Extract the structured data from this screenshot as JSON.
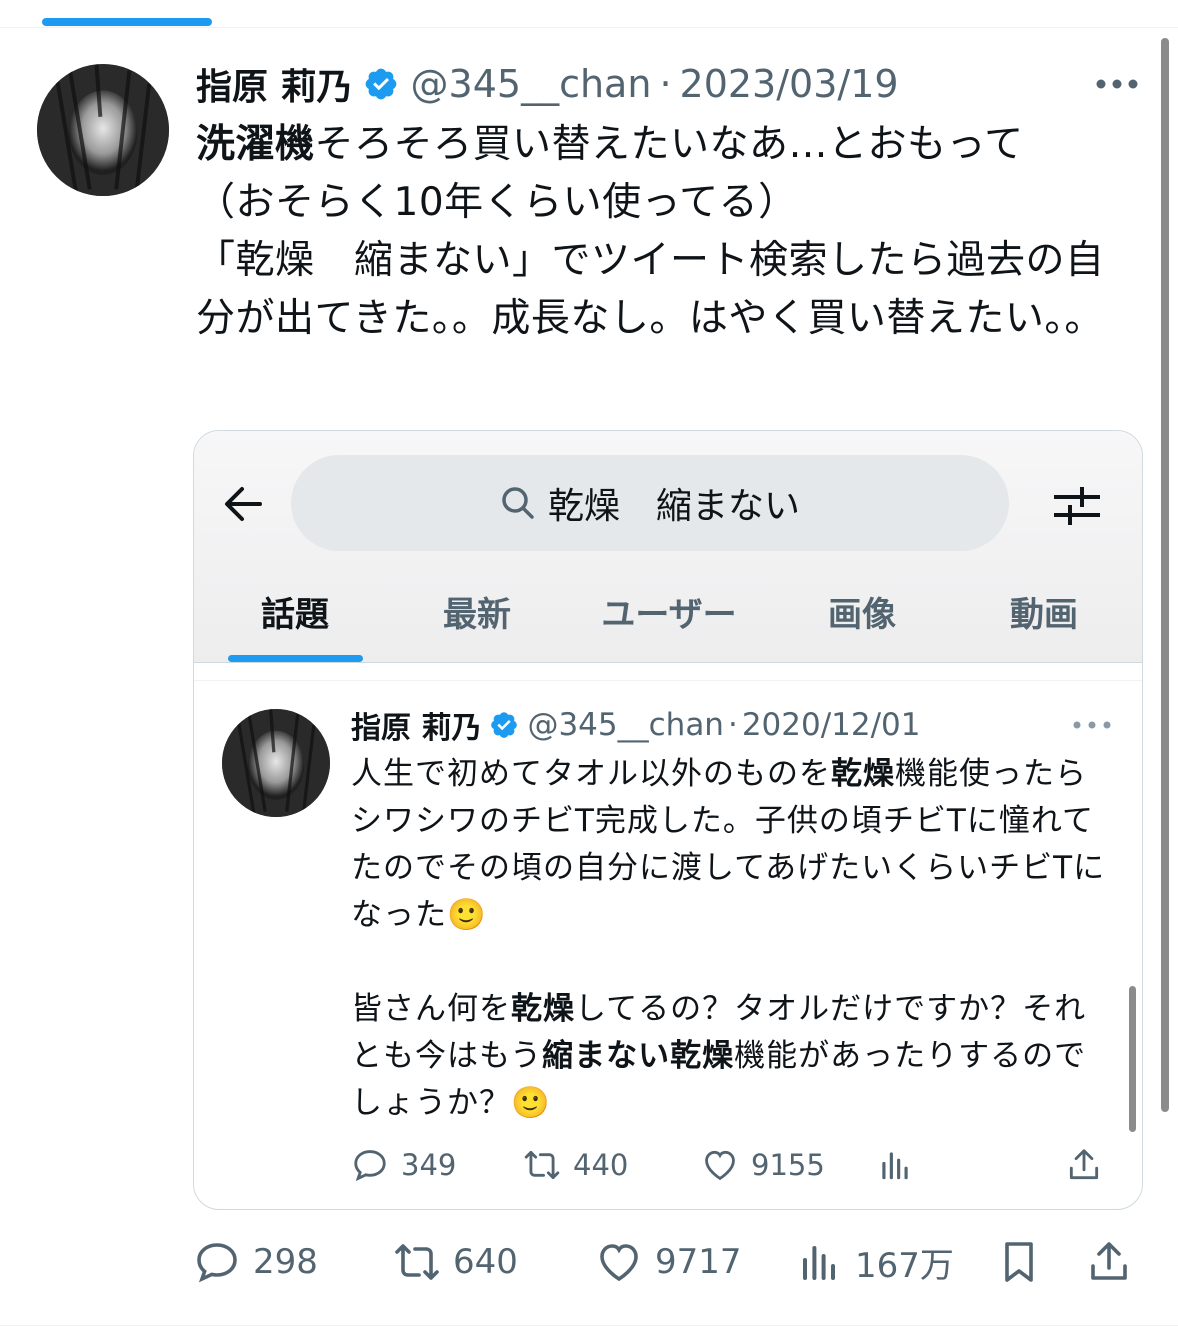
{
  "tweet": {
    "display_name": "指原 莉乃",
    "handle": "@345__chan",
    "separator": "·",
    "date": "2023/03/19",
    "text_bold_prefix": "洗濯機",
    "text_rest": "そろそろ買い替えたいなあ…とおもって\n（おそらく10年くらい使ってる）\n「乾燥　縮まない」でツイート検索したら過去の自分が出てきた。。成長なし。はやく買い替えたい。。",
    "icons": {
      "verified": "verified-badge-icon",
      "more": "more-icon",
      "reply": "reply-icon",
      "retweet": "retweet-icon",
      "like": "heart-icon",
      "views": "views-icon",
      "bookmark": "bookmark-icon",
      "share": "share-icon"
    },
    "stats": {
      "replies": "298",
      "retweets": "640",
      "likes": "9717",
      "views": "167万"
    }
  },
  "screenshot": {
    "search_query": "乾燥　縮まない",
    "tabs": [
      "話題",
      "最新",
      "ユーザー",
      "画像",
      "動画"
    ],
    "active_tab": "話題",
    "icons": {
      "back": "back-arrow-icon",
      "search": "search-icon",
      "filter": "filter-settings-icon"
    },
    "inner_tweet": {
      "display_name": "指原 莉乃",
      "handle": "@345__chan",
      "separator": "·",
      "date": "2020/12/01",
      "segments": [
        "人生で初めてタオル以外のものを",
        "乾燥",
        "機能使ったらシワシワのチビT完成した。子供の頃チビTに憧れてたのでその頃の自分に渡してあげたいくらいチビTになった🙂\n\n皆さん何を",
        "乾燥",
        "してるの？タオルだけですか？それとも今はもう",
        "縮まない乾燥",
        "機能があったりするのでしょうか？🙂"
      ],
      "stats": {
        "replies": "349",
        "retweets": "440",
        "likes": "9155"
      }
    }
  },
  "colors": {
    "accent": "#1d9bf0",
    "text": "#0f1419",
    "secondary": "#536471",
    "border": "#cfd9de"
  }
}
